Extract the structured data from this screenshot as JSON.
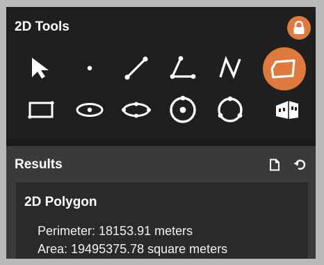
{
  "tools_panel": {
    "title": "2D Tools",
    "lock_icon": "lock-icon",
    "accent_color": "#e07a3c",
    "tools": [
      {
        "name": "select",
        "icon": "cursor-arrow-icon",
        "active": false
      },
      {
        "name": "point",
        "icon": "point-icon",
        "active": false
      },
      {
        "name": "line",
        "icon": "line-icon",
        "active": false
      },
      {
        "name": "angle",
        "icon": "angle-icon",
        "active": false
      },
      {
        "name": "polyline",
        "icon": "polyline-icon",
        "active": false
      },
      {
        "name": "polygon",
        "icon": "polygon-icon",
        "active": true
      },
      {
        "name": "rectangle",
        "icon": "rectangle-icon",
        "active": false
      },
      {
        "name": "ellipse",
        "icon": "ellipse-icon",
        "active": false
      },
      {
        "name": "ellipse-points",
        "icon": "ellipse-points-icon",
        "active": false
      },
      {
        "name": "circle-center",
        "icon": "circle-center-icon",
        "active": false
      },
      {
        "name": "circle-points",
        "icon": "circle-points-icon",
        "active": false
      },
      {
        "name": "building",
        "icon": "building-icon",
        "active": false
      }
    ]
  },
  "results_panel": {
    "title": "Results",
    "export_icon": "document-icon",
    "reset_icon": "undo-icon",
    "result": {
      "title": "2D Polygon",
      "perimeter": "Perimeter: 18153.91 meters",
      "area": "Area: 19495375.78 square meters"
    }
  }
}
